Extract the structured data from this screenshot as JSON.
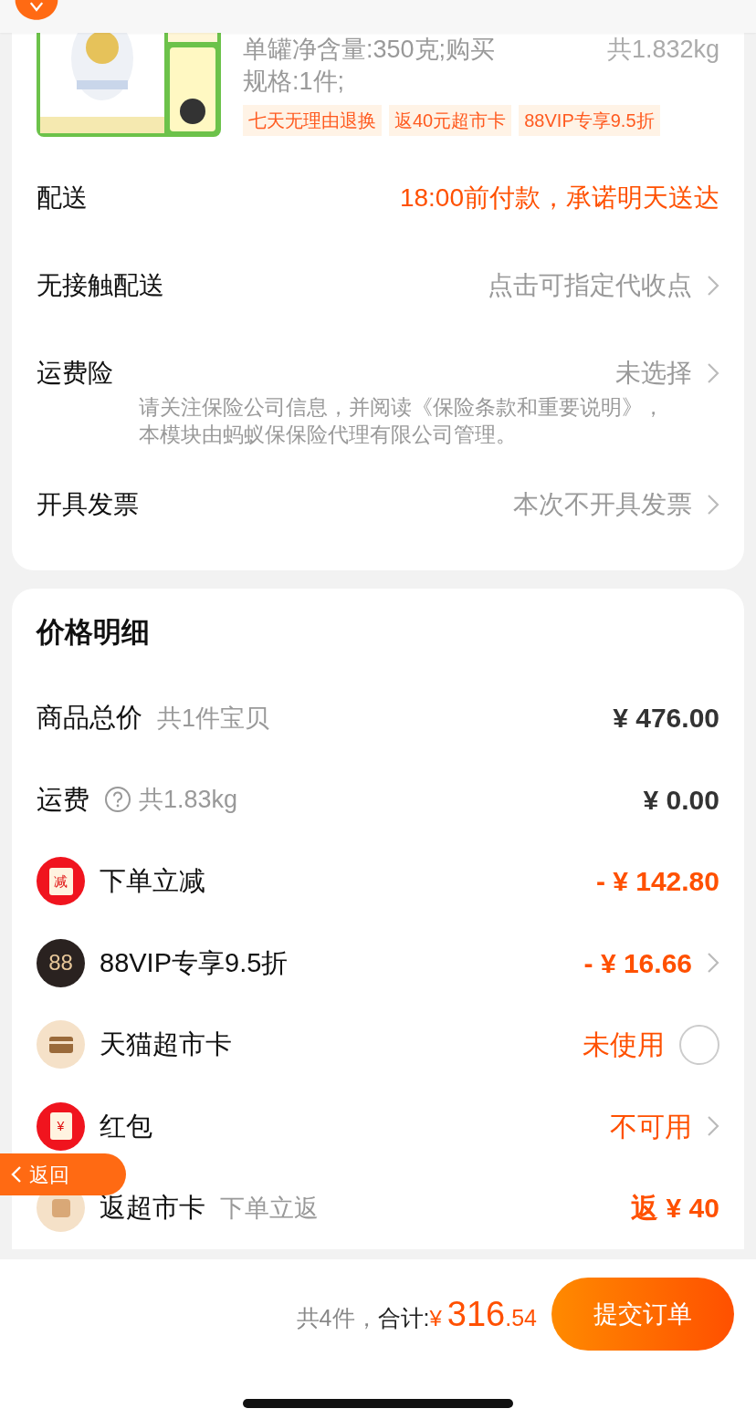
{
  "product": {
    "spec": "单罐净含量:350克;购买规格:1件;",
    "weight": "共1.832kg",
    "tags": [
      "七天无理由退换",
      "返40元超市卡",
      "88VIP专享9.5折"
    ]
  },
  "order_rows": [
    {
      "label": "配送",
      "value": "18:00前付款，承诺明天送达",
      "accent": true,
      "arrow": false
    },
    {
      "label": "无接触配送",
      "value": "点击可指定代收点",
      "accent": false,
      "arrow": true
    },
    {
      "label": "运费险",
      "value": "未选择",
      "accent": false,
      "arrow": true,
      "note": "请关注保险公司信息，并阅读《保险条款和重要说明》，本模块由蚂蚁保保险代理有限公司管理。"
    },
    {
      "label": "开具发票",
      "value": "本次不开具发票",
      "accent": false,
      "arrow": true
    }
  ],
  "price_details": {
    "title": "价格明细",
    "rows": [
      {
        "kind": "plain",
        "label": "商品总价",
        "sub": "共1件宝贝",
        "amount": "¥ 476.00",
        "accent": false
      },
      {
        "kind": "help",
        "label": "运费",
        "sub": "共1.83kg",
        "amount": "¥ 0.00",
        "accent": false
      },
      {
        "kind": "discount",
        "icon_text": "减",
        "label": "下单立减",
        "amount": "- ¥ 142.80",
        "accent": true
      },
      {
        "kind": "vip",
        "icon_text": "88",
        "label": "88VIP专享9.5折",
        "amount": "- ¥ 16.66",
        "accent": true,
        "arrow": true
      },
      {
        "kind": "card",
        "label": "天猫超市卡",
        "amount": "未使用",
        "accent": true,
        "checked": false
      },
      {
        "kind": "redpacket",
        "icon_text": "¥",
        "label": "红包",
        "amount": "不可用",
        "accent": true,
        "arrow": true
      },
      {
        "kind": "rebate",
        "label": "返超市卡",
        "sub": "下单立返",
        "amount": "返 ¥ 40",
        "accent": true
      }
    ]
  },
  "back_button": {
    "label": "返回"
  },
  "footer": {
    "count": "共4件，",
    "total_label": "合计:",
    "currency": "¥",
    "total_int": "316",
    "total_dec": ".54",
    "submit": "提交订单"
  }
}
